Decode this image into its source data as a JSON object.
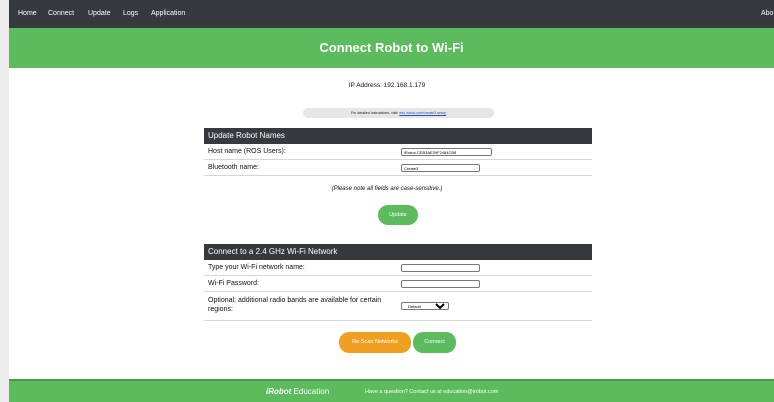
{
  "nav": {
    "items": [
      "Home",
      "Connect",
      "Update",
      "Logs",
      "Application"
    ],
    "right_item": "Abo"
  },
  "banner": {
    "title": "Connect Robot to Wi-Fi"
  },
  "ip_text": "IP Address: 192.168.1.179",
  "info": {
    "prefix": "For detailed instructions, visit:",
    "link": "edu.irobot.com/create3-setup"
  },
  "names_section": {
    "header": "Update Robot Names",
    "host_label": "Host name (ROS Users):",
    "host_value": "iRobot-CEB3AE39F2484CB8",
    "bt_label": "Bluetooth name:",
    "bt_value": "Create3"
  },
  "note": "(Please note all fields are case-sensitive.)",
  "update_button": "Update",
  "wifi_section": {
    "header": "Connect to a 2.4 GHz Wi-Fi Network",
    "ssid_label": "Type your Wi-Fi network name:",
    "ssid_value": "",
    "password_label": "Wi-Fi Password:",
    "password_value": "",
    "bands_label": "Optional: additional radio bands are available for certain regions:",
    "bands_selected": "Default"
  },
  "rescan_button": "Re-Scan Networks",
  "connect_button": "Connect",
  "footer": {
    "brand_logo": "iRobot",
    "brand_text": "Education",
    "contact": "Have a question? Contact us at education@irobot.com"
  },
  "colors": {
    "nav_bg": "#36393d",
    "accent_green": "#5cbb5c",
    "accent_orange": "#f0a020"
  }
}
